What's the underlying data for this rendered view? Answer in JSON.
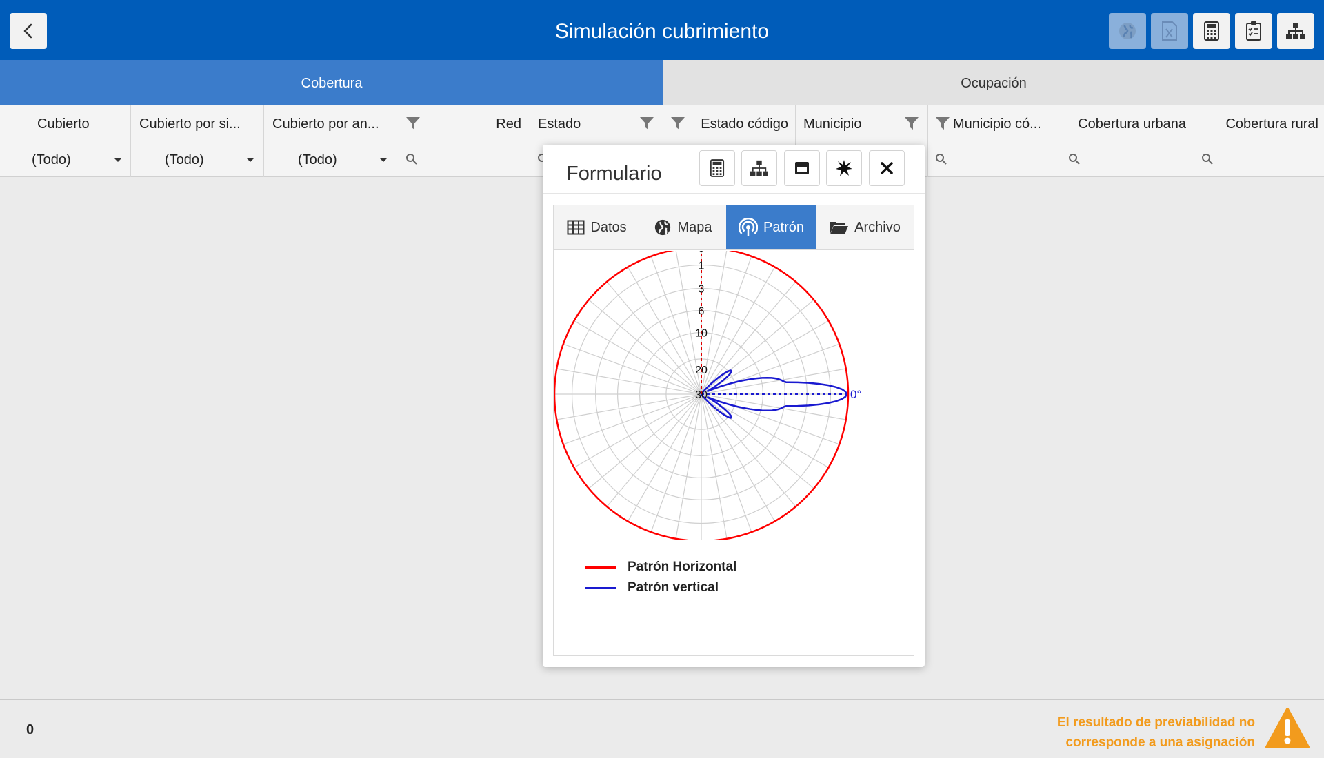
{
  "header": {
    "title": "Simulación cubrimiento",
    "back_icon": "chevron-left-icon",
    "buttons": [
      {
        "name": "globe-icon",
        "disabled": true
      },
      {
        "name": "excel-icon",
        "disabled": true
      },
      {
        "name": "calculator-icon",
        "disabled": false
      },
      {
        "name": "clipboard-check-icon",
        "disabled": false
      },
      {
        "name": "sitemap-icon",
        "disabled": false
      }
    ]
  },
  "tabs": [
    {
      "label": "Cobertura",
      "active": true
    },
    {
      "label": "Ocupación",
      "active": false
    }
  ],
  "grid": {
    "columns": [
      {
        "label": "Cubierto",
        "filter": "(Todo)"
      },
      {
        "label": "Cubierto por si...",
        "filter": "(Todo)"
      },
      {
        "label": "Cubierto por an...",
        "filter": "(Todo)"
      },
      {
        "label": "Red",
        "filter": ""
      },
      {
        "label": "Estado",
        "filter": ""
      },
      {
        "label": "Estado código",
        "filter": ""
      },
      {
        "label": "Municipio",
        "filter": ""
      },
      {
        "label": "Municipio có...",
        "filter": ""
      },
      {
        "label": "Cobertura urbana",
        "filter": ""
      },
      {
        "label": "Cobertura rural",
        "filter": ""
      }
    ]
  },
  "modal": {
    "title": "Formulario",
    "buttons": [
      "calculator-icon",
      "sitemap-icon",
      "window-icon",
      "burst-icon",
      "close-icon"
    ],
    "tabs": [
      {
        "label": "Datos",
        "icon": "table-icon",
        "active": false
      },
      {
        "label": "Mapa",
        "icon": "globe-icon",
        "active": false
      },
      {
        "label": "Patrón",
        "icon": "antenna-icon",
        "active": true
      },
      {
        "label": "Archivo",
        "icon": "folder-open-icon",
        "active": false
      }
    ]
  },
  "chart_data": {
    "type": "polar",
    "radial_ticks": [
      "0",
      "1",
      "3",
      "6",
      "10",
      "20",
      "30"
    ],
    "angle_markers": {
      "horizontal": "0°",
      "vertical": "0°"
    },
    "angular_grid_step_deg": 10,
    "series": [
      {
        "name": "Patrón Horizontal",
        "color": "#ff0000",
        "shape": "omnidirectional",
        "attenuation_db": 0
      },
      {
        "name": "Patrón vertical",
        "color": "#0000cc",
        "shape": "main lobe toward 0° with side lobes",
        "peak_attenuation_db": 0
      }
    ]
  },
  "footer": {
    "count": "0",
    "warning_line1": "El resultado de previabilidad no",
    "warning_line2": "corresponde a una asignación",
    "warning_color": "#f29b1d"
  }
}
